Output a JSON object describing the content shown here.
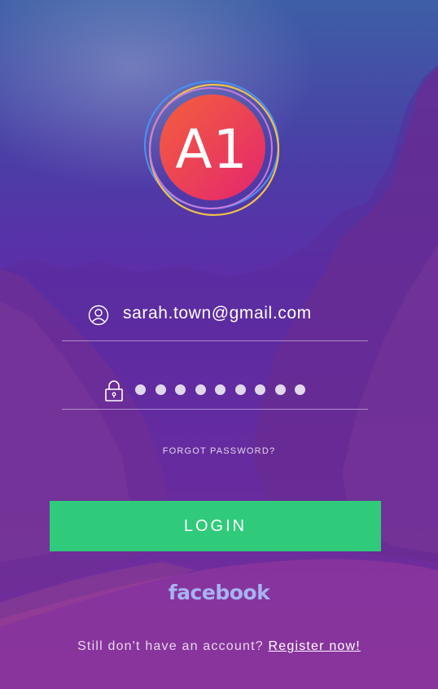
{
  "logo": {
    "text": "A1"
  },
  "email": {
    "value": "sarah.town@gmail.com"
  },
  "password": {
    "masked_length": 9
  },
  "forgot_password": "FORGOT PASSWORD?",
  "login_button": "LOGIN",
  "facebook_label": "facebook",
  "register": {
    "prompt": "Still don't have an account?",
    "link": "Register now!"
  },
  "colors": {
    "login_button": "#2fcb7a",
    "logo_gradient_start": "#f4603c",
    "logo_gradient_end": "#e3256f",
    "facebook_text": "#a7b3f2"
  },
  "icons": {
    "email": "user-circle-icon",
    "password": "lock-icon"
  }
}
